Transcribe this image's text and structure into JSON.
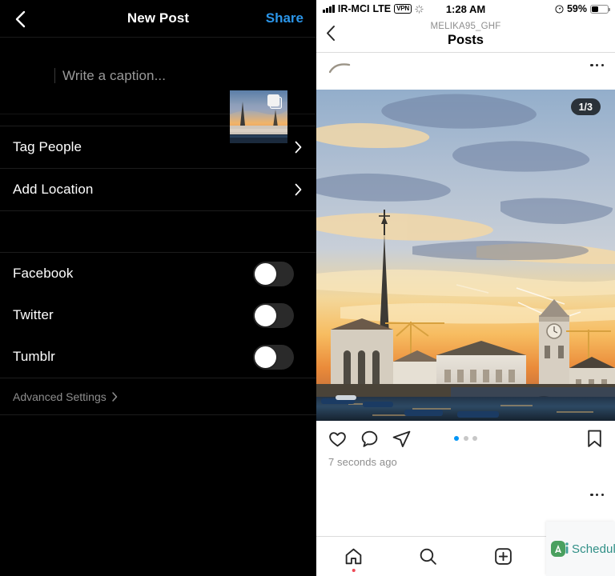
{
  "left": {
    "header": {
      "back_icon": "chevron-left-icon",
      "title": "New Post",
      "share_label": "Share"
    },
    "caption": {
      "placeholder": "Write a caption...",
      "thumbnail_icon": "multiple-photos-icon"
    },
    "list_items": [
      {
        "label": "Tag People",
        "chevron_icon": "chevron-right-icon"
      },
      {
        "label": "Add Location",
        "chevron_icon": "chevron-right-icon"
      }
    ],
    "toggles": [
      {
        "label": "Facebook",
        "on": false
      },
      {
        "label": "Twitter",
        "on": false
      },
      {
        "label": "Tumblr",
        "on": false
      }
    ],
    "advanced": {
      "label": "Advanced Settings",
      "chevron_icon": "chevron-right-icon"
    }
  },
  "right": {
    "statusbar": {
      "carrier": "IR-MCI",
      "network": "LTE",
      "vpn_label": "VPN",
      "signal_icon": "signal-bars-icon",
      "spinner_icon": "activity-spinner-icon",
      "time": "1:28 AM",
      "location_icon": "location-arrow-icon",
      "battery_percent": "59%",
      "battery_icon": "battery-icon",
      "battery_level": 40
    },
    "nav": {
      "back_icon": "chevron-left-icon",
      "subtitle": "MELIKA95_GHF",
      "title": "Posts"
    },
    "post": {
      "uploading_icon": "loading-arc-icon",
      "menu_icon": "more-options-icon",
      "carousel_counter": "1/3",
      "actions": {
        "like_icon": "heart-icon",
        "comment_icon": "comment-bubble-icon",
        "share_icon": "send-paperplane-icon",
        "save_icon": "bookmark-icon"
      },
      "pager": {
        "total": 3,
        "active": 1
      },
      "timestamp": "7 seconds ago"
    },
    "next_post": {
      "menu_icon": "more-options-icon"
    },
    "tabbar": [
      {
        "icon": "home-icon",
        "badge": true
      },
      {
        "icon": "search-icon",
        "badge": false
      },
      {
        "icon": "add-post-icon",
        "badge": false
      },
      {
        "icon": "activity-heart-icon",
        "badge": false
      }
    ],
    "widget": {
      "logo_icon": "aischedul-logo-icon",
      "text": "Schedul"
    }
  },
  "colors": {
    "accent_blue": "#2b95e8",
    "pager_active": "#0095f6",
    "badge_red": "#ed4956",
    "widget_teal": "#2f8f86",
    "dark_bg": "#000000",
    "muted_gray": "#8e8e8e"
  }
}
